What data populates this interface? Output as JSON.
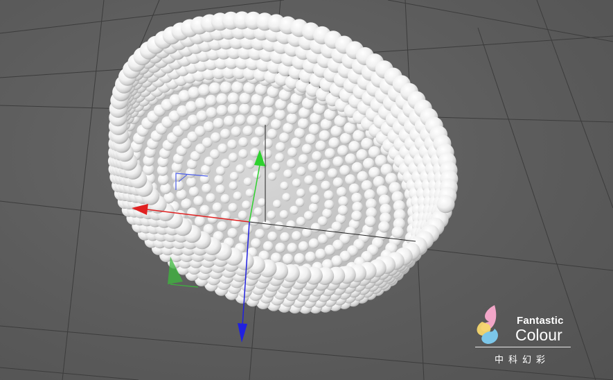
{
  "viewport": {
    "background": "#5a5a5a",
    "grid_color": "#3c3c3c",
    "object": "sphere-cloned hemisphere (bowl)",
    "sphere_color": "#f2f2f2"
  },
  "gizmo": {
    "x_axis_color": "#e02020",
    "y_axis_color": "#2ed12e",
    "z_axis_color": "#2020e0"
  },
  "watermark": {
    "brand_line1": "Fantastic",
    "brand_line2": "Colour",
    "brand_cn": "中科幻彩",
    "logo_colors": [
      "#f2a6c8",
      "#f5d76e",
      "#7cc7ea"
    ]
  }
}
